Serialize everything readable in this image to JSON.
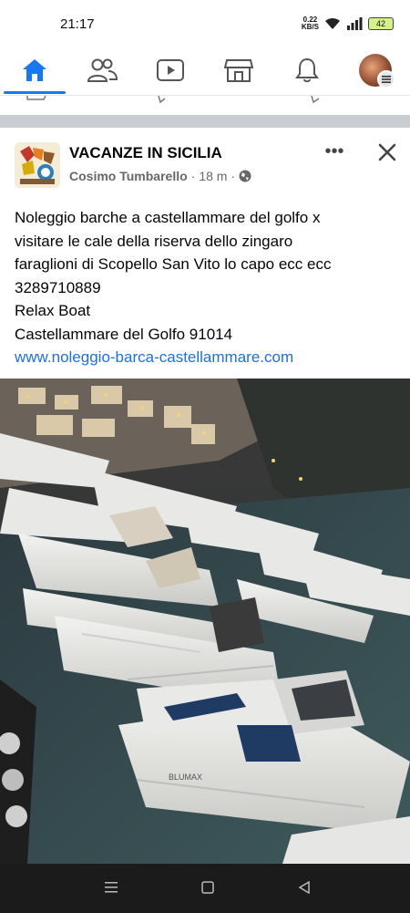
{
  "status_bar": {
    "time": "21:17",
    "net_speed_value": "0.22",
    "net_speed_unit": "KB/S",
    "battery": "42"
  },
  "nav": {
    "tabs": [
      {
        "icon": "home-icon",
        "active": true
      },
      {
        "icon": "friends-icon",
        "active": false
      },
      {
        "icon": "watch-icon",
        "active": false
      },
      {
        "icon": "marketplace-icon",
        "active": false
      },
      {
        "icon": "bell-icon",
        "active": false
      },
      {
        "icon": "profile-avatar",
        "active": false
      }
    ]
  },
  "post": {
    "group_name": "VACANZE IN SICILIA",
    "author": "Cosimo Tumbarello",
    "meta_separator": "·",
    "time": "18 m",
    "visibility_icon": "globe-icon",
    "more_label": "•••",
    "text_lines": [
      "Noleggio barche a castellammare del golfo x",
      "visitare le cale della riserva dello zingaro",
      "faraglioni di Scopello San Vito lo capo ecc ecc",
      "3289710889",
      "Relax Boat",
      "Castellammare del Golfo 91014"
    ],
    "link": "www.noleggio-barca-castellammare.com",
    "image_boat_brand": "BLUMAX"
  },
  "colors": {
    "accent": "#1877f2",
    "link": "#216fdb",
    "secondary_text": "#65676b",
    "separator": "#c9ccd1"
  }
}
